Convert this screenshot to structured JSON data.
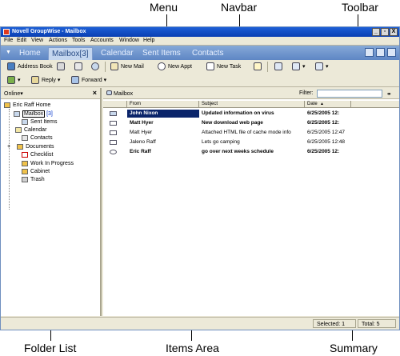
{
  "callouts": {
    "menu": "Menu",
    "navbar": "Navbar",
    "toolbar": "Toolbar",
    "folder_list": "Folder List",
    "items_area": "Items Area",
    "summary": "Summary"
  },
  "window": {
    "title": "Novell GroupWise - Mailbox",
    "minimize": "_",
    "restore": "▫",
    "close": "X"
  },
  "menu": [
    "File",
    "Edit",
    "View",
    "Actions",
    "Tools",
    "Accounts",
    "Window",
    "Help"
  ],
  "navbar": {
    "arrow": "▼",
    "tabs": [
      "Home",
      "Mailbox[3]",
      "Calendar",
      "Sent Items",
      "Contacts"
    ],
    "active_index": 1
  },
  "toolbar": {
    "address_book": "Address Book",
    "new_mail": "New Mail",
    "new_appt": "New Appt",
    "new_task": "New Task",
    "reply": "Reply",
    "forward": "Forward",
    "dropdown": "▾"
  },
  "folders": {
    "online_label": "Online▾",
    "close": "×",
    "root": "Eric Raff Home",
    "mailbox": "Mailbox",
    "mailbox_count": "[3]",
    "items": [
      "Sent Items",
      "Calendar",
      "Contacts",
      "Documents",
      "Checklist",
      "Work In Progress",
      "Cabinet",
      "Trash"
    ]
  },
  "items": {
    "breadcrumb": "Mailbox",
    "filter_label": "Filter:",
    "columns": {
      "from": "From",
      "subject": "Subject",
      "date": "Date",
      "sort_arrow": "▲"
    },
    "rows": [
      {
        "from": "John Nixon",
        "subject": "Updated information on virus",
        "date": "6/25/2005 12:",
        "bold": true,
        "selected": true
      },
      {
        "from": "Matt Hyer",
        "subject": "New download web page",
        "date": "6/25/2005 12:",
        "bold": true,
        "selected": false
      },
      {
        "from": "Matt Hyer",
        "subject": "Attached HTML file of cache mode info",
        "date": "6/25/2005 12:47",
        "bold": false,
        "selected": false
      },
      {
        "from": "Jaleno Raff",
        "subject": "Lets go camping",
        "date": "6/25/2005 12:48",
        "bold": false,
        "selected": false
      },
      {
        "from": "Eric Raff",
        "subject": "go over next weeks schedule",
        "date": "6/25/2005 12:",
        "bold": true,
        "selected": false
      }
    ]
  },
  "status": {
    "selected": "Selected: 1",
    "total": "Total: 5"
  },
  "colors": {
    "titlebar": "#0a3fb3",
    "navbar": "#5e86c4",
    "selection": "#0a246a"
  }
}
